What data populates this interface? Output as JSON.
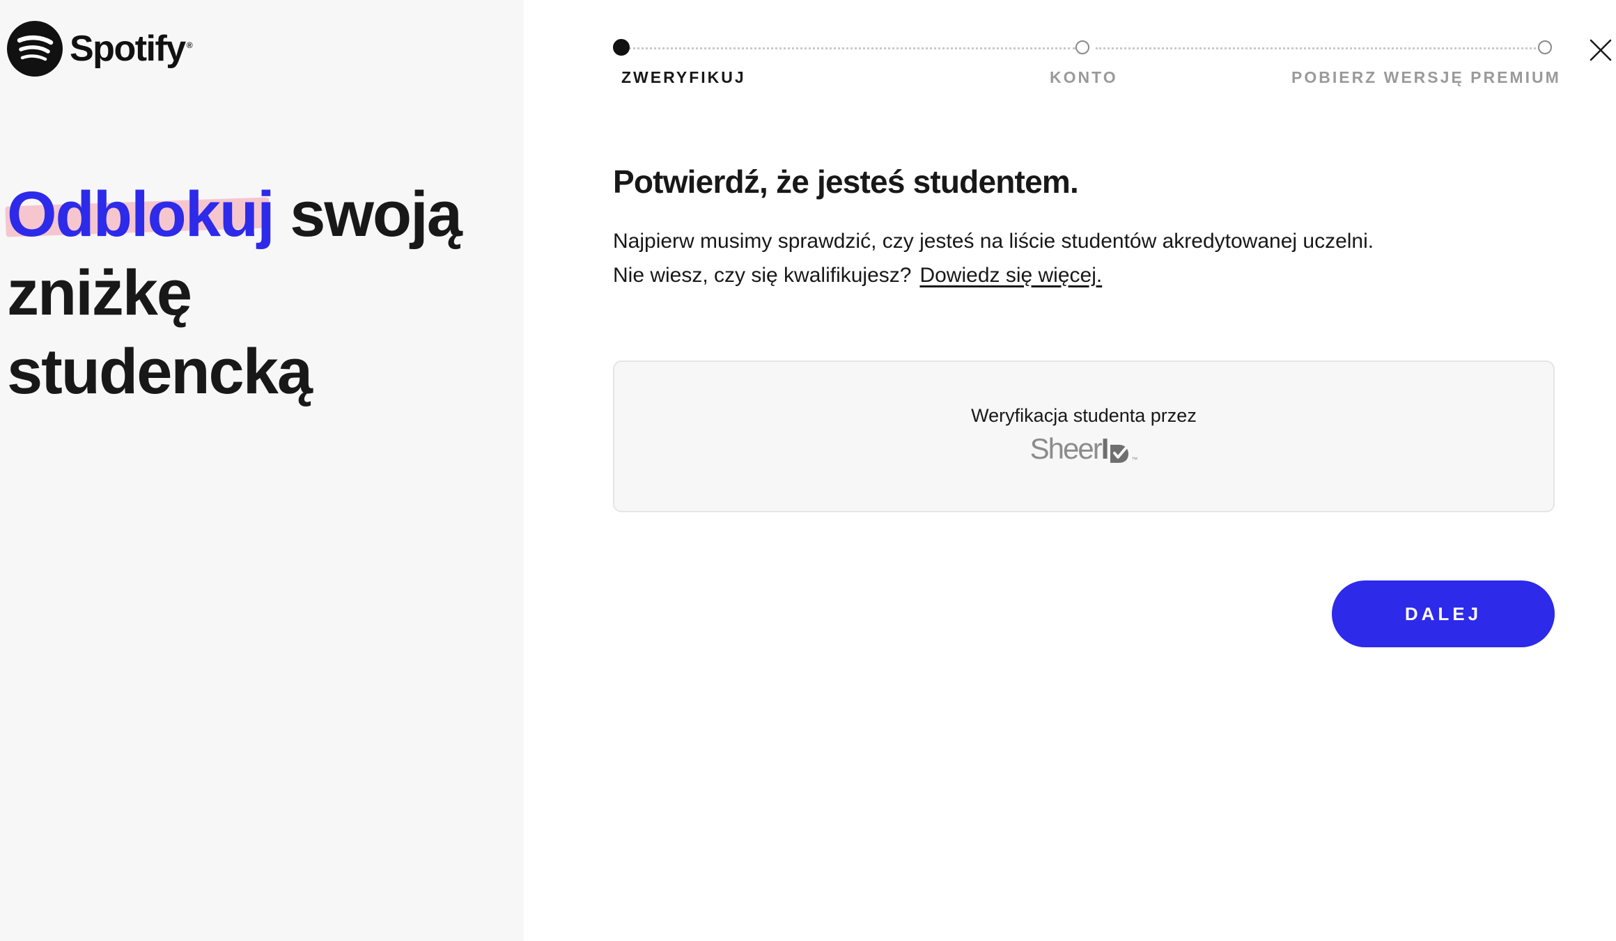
{
  "brand": {
    "name": "Spotify",
    "reg_mark": "®",
    "logo_icon": "spotify-logo-icon"
  },
  "hero": {
    "accent_word": "Odblokuj",
    "rest_line1": "swoją",
    "line2": "zniżkę",
    "line3": "studencką"
  },
  "stepper": {
    "steps": [
      {
        "label": "ZWERYFIKUJ",
        "state": "active"
      },
      {
        "label": "KONTO",
        "state": "inactive"
      },
      {
        "label": "POBIERZ WERSJĘ PREMIUM",
        "state": "inactive"
      }
    ]
  },
  "main": {
    "title": "Potwierdź, że jesteś studentem.",
    "description_line1": "Najpierw musimy sprawdzić, czy jesteś na liście studentów akredytowanej uczelni.",
    "description_line2": "Nie wiesz, czy się kwalifikujesz?",
    "learn_more_link": "Dowiedz się więcej."
  },
  "verification": {
    "label": "Weryfikacja studenta przez",
    "provider_part1": "Sheer",
    "provider_part2": "I",
    "provider_tm": "™",
    "provider_icon": "sheerid-logo-icon"
  },
  "actions": {
    "next_label": "DALEJ",
    "close_icon": "close-icon"
  },
  "colors": {
    "accent": "#2d2aea",
    "highlight": "#f6c6cf",
    "left_panel_bg": "#f7f7f7",
    "text": "#181818",
    "muted": "#9a9a9a"
  }
}
